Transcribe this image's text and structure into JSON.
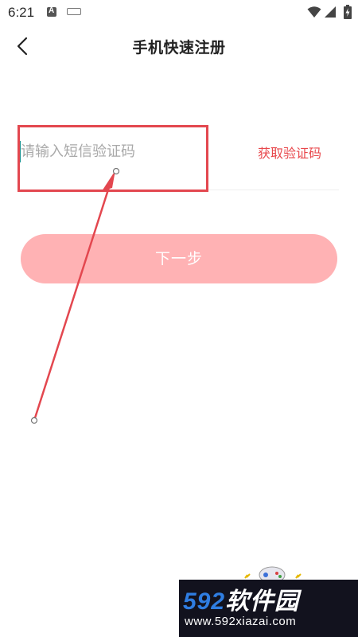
{
  "status_bar": {
    "time": "6:21",
    "icons": [
      "a-icon",
      "keyboard-icon",
      "wifi-icon",
      "signal-icon",
      "battery-icon"
    ]
  },
  "header": {
    "back_icon": "chevron-left-icon",
    "title": "手机快速注册"
  },
  "form": {
    "code_input": {
      "value": "",
      "placeholder": "请输入短信验证码"
    },
    "get_code_label": "获取验证码",
    "next_label": "下一步"
  },
  "colors": {
    "accent": "#e8474b",
    "button_disabled": "#ffb2b4",
    "annotation": "#e3474f"
  },
  "watermark": {
    "brand_num": "592",
    "brand_text": "软件园",
    "url": "www.592xiazai.com"
  }
}
